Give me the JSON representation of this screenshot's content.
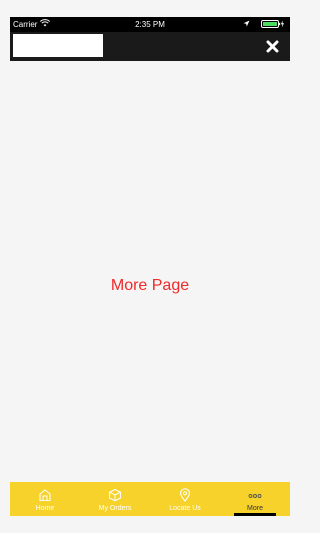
{
  "status_bar": {
    "carrier": "Carrier",
    "time": "2:35 PM"
  },
  "header": {
    "close_icon": "close-icon"
  },
  "main": {
    "page_text": "More Page"
  },
  "tab_bar": {
    "tabs": [
      {
        "label": "Home",
        "icon": "home-icon",
        "active": false
      },
      {
        "label": "My Orders",
        "icon": "box-icon",
        "active": false
      },
      {
        "label": "Locate Us",
        "icon": "location-pin-icon",
        "active": false
      },
      {
        "label": "More",
        "icon": "more-dots-icon",
        "active": true
      }
    ]
  },
  "colors": {
    "accent": "#f6d22a",
    "header": "#1a1a1a",
    "page_text": "#ee2a2a"
  }
}
